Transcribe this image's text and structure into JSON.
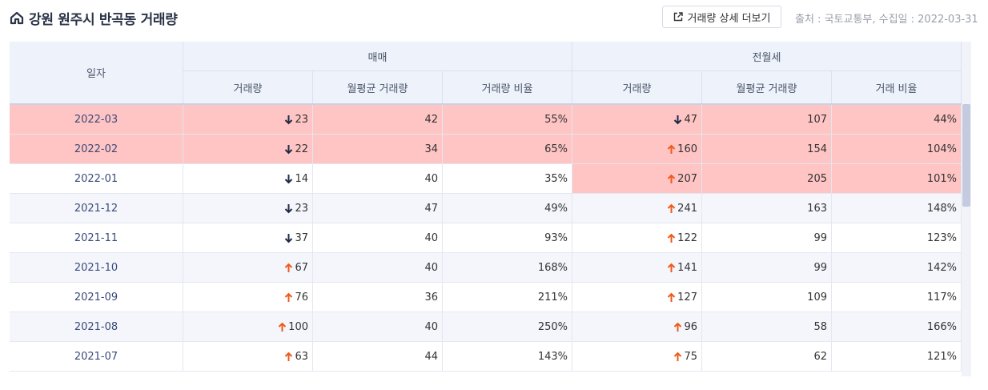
{
  "header": {
    "title": "강원 원주시 반곡동 거래량",
    "more_button": "거래량 상세 더보기",
    "source": "출처 : 국토교통부, 수집일 : 2022-03-31"
  },
  "table": {
    "col_date": "일자",
    "group_sale": "매매",
    "group_rent": "전월세",
    "sub_headers": [
      "거래량",
      "월평균 거래량",
      "거래량 비율",
      "거래량",
      "월평균 거래량",
      "거래 비율"
    ],
    "rows": [
      {
        "date": "2022-03",
        "sale_vol": "23",
        "sale_dir": "down",
        "sale_avg": "42",
        "sale_ratio": "55%",
        "rent_vol": "47",
        "rent_dir": "down",
        "rent_avg": "107",
        "rent_ratio": "44%",
        "highlight": "both"
      },
      {
        "date": "2022-02",
        "sale_vol": "22",
        "sale_dir": "down",
        "sale_avg": "34",
        "sale_ratio": "65%",
        "rent_vol": "160",
        "rent_dir": "up",
        "rent_avg": "154",
        "rent_ratio": "104%",
        "highlight": "both"
      },
      {
        "date": "2022-01",
        "sale_vol": "14",
        "sale_dir": "down",
        "sale_avg": "40",
        "sale_ratio": "35%",
        "rent_vol": "207",
        "rent_dir": "up",
        "rent_avg": "205",
        "rent_ratio": "101%",
        "highlight": "rent"
      },
      {
        "date": "2021-12",
        "sale_vol": "23",
        "sale_dir": "down",
        "sale_avg": "47",
        "sale_ratio": "49%",
        "rent_vol": "241",
        "rent_dir": "up",
        "rent_avg": "163",
        "rent_ratio": "148%",
        "highlight": "none"
      },
      {
        "date": "2021-11",
        "sale_vol": "37",
        "sale_dir": "down",
        "sale_avg": "40",
        "sale_ratio": "93%",
        "rent_vol": "122",
        "rent_dir": "up",
        "rent_avg": "99",
        "rent_ratio": "123%",
        "highlight": "none"
      },
      {
        "date": "2021-10",
        "sale_vol": "67",
        "sale_dir": "up",
        "sale_avg": "40",
        "sale_ratio": "168%",
        "rent_vol": "141",
        "rent_dir": "up",
        "rent_avg": "99",
        "rent_ratio": "142%",
        "highlight": "none"
      },
      {
        "date": "2021-09",
        "sale_vol": "76",
        "sale_dir": "up",
        "sale_avg": "36",
        "sale_ratio": "211%",
        "rent_vol": "127",
        "rent_dir": "up",
        "rent_avg": "109",
        "rent_ratio": "117%",
        "highlight": "none"
      },
      {
        "date": "2021-08",
        "sale_vol": "100",
        "sale_dir": "up",
        "sale_avg": "40",
        "sale_ratio": "250%",
        "rent_vol": "96",
        "rent_dir": "up",
        "rent_avg": "58",
        "rent_ratio": "166%",
        "highlight": "none"
      },
      {
        "date": "2021-07",
        "sale_vol": "63",
        "sale_dir": "up",
        "sale_avg": "44",
        "sale_ratio": "143%",
        "rent_vol": "75",
        "rent_dir": "up",
        "rent_avg": "62",
        "rent_ratio": "121%",
        "highlight": "none"
      }
    ]
  },
  "colors": {
    "highlight": "#ffc4c4",
    "row_alt": "#f4f6fb",
    "arrow_up": "#f05a1a",
    "arrow_down": "#1e2a46"
  }
}
